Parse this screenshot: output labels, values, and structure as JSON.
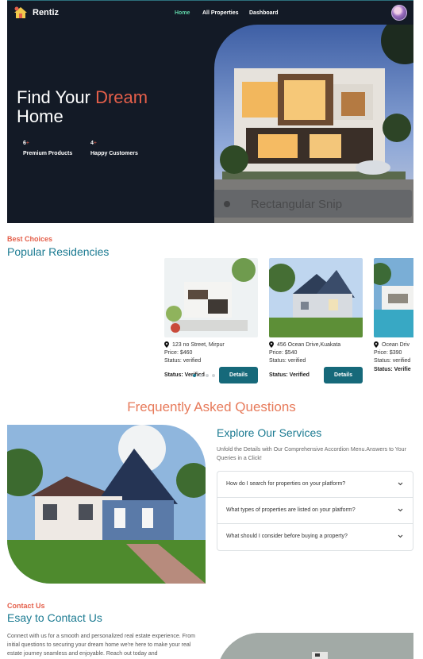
{
  "nav": {
    "brand": "Rentiz",
    "links": [
      "Home",
      "All Properties",
      "Dashboard"
    ]
  },
  "hero": {
    "title_part1": "Find Your ",
    "title_accent": "Dream",
    "title_part2": "Home",
    "stats": [
      {
        "num": "6",
        "plus": "+",
        "label": "Premium Products"
      },
      {
        "num": "4",
        "plus": "+",
        "label": "Happy Customers"
      }
    ],
    "overlay_text": "Rectangular Snip"
  },
  "residencies": {
    "eyebrow": "Best Choices",
    "title": "Popular Residencies",
    "cards": [
      {
        "address": "123 no Street, Mirpur",
        "price": "Price: $460",
        "status_line": "Status: verified",
        "status_bold": "Status: Verified",
        "button": "Details"
      },
      {
        "address": "456 Ocean Drive,Kuakata",
        "price": "Price: $540",
        "status_line": "Status: verified",
        "status_bold": "Status: Verified",
        "button": "Details"
      },
      {
        "address": "Ocean Driv",
        "price": "Price: $390",
        "status_line": "Status: verified",
        "status_bold": "Status: Verifie",
        "button": ""
      }
    ]
  },
  "faq": {
    "title": "Frequently Asked Questions",
    "heading": "Explore Our Services",
    "subtitle": "Unfold the Details with Our Comprehensive Accordion Menu.Answers to Your Queries in a Click!",
    "questions": [
      "How do I search for properties on your platform?",
      "What types of properties are listed on your platform?",
      "What should I consider before buying a property?"
    ]
  },
  "contact": {
    "eyebrow": "Contact Us",
    "title": "Esay to Contact Us",
    "text": "Connect with us for a smooth and personalized real estate experience. From initial questions to securing your dream home we're here to make your real estate journey seamless and enjoyable. Reach out today and"
  },
  "colors": {
    "accent": "#e45f4a",
    "teal": "#1c7b92",
    "dark": "#131a26",
    "active_nav": "#5fd1a6"
  }
}
